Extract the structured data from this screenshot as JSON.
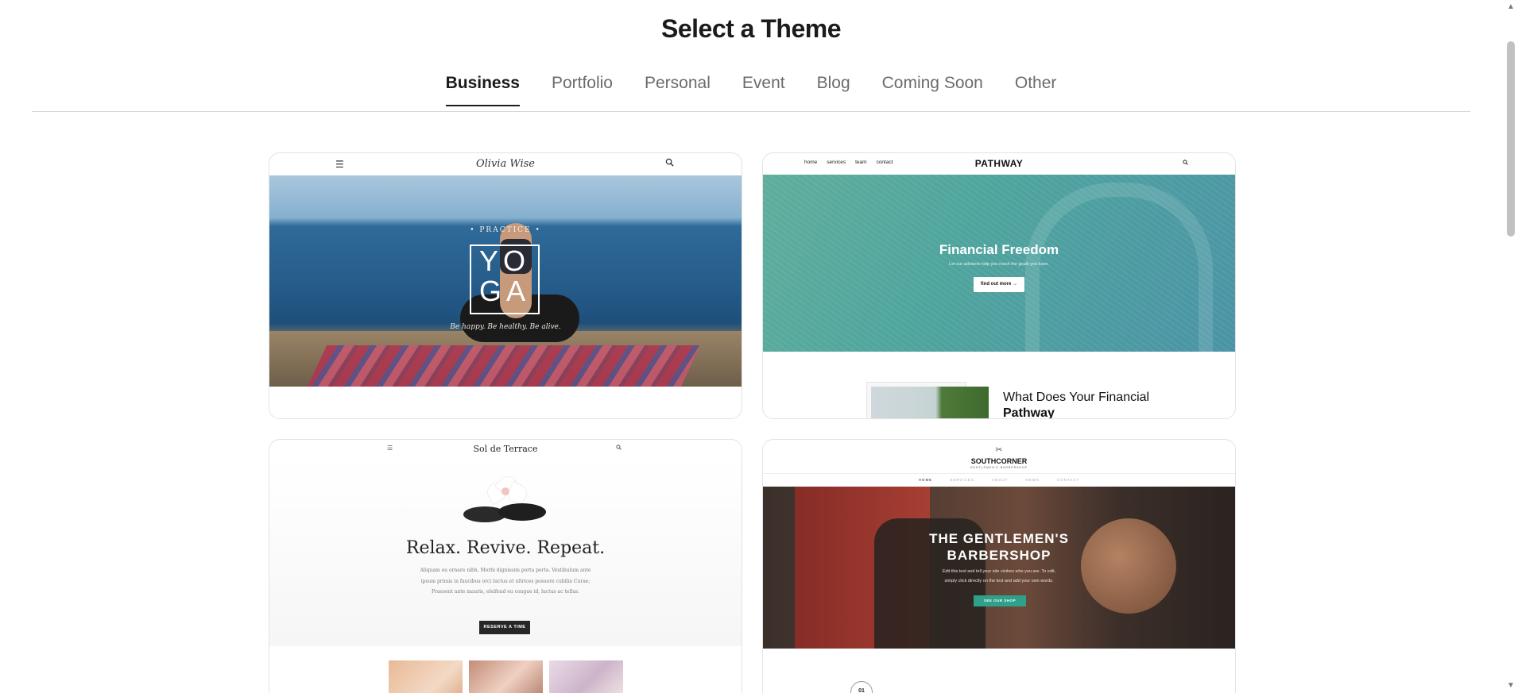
{
  "page": {
    "title": "Select a Theme"
  },
  "tabs": [
    {
      "label": "Business",
      "active": true
    },
    {
      "label": "Portfolio",
      "active": false
    },
    {
      "label": "Personal",
      "active": false
    },
    {
      "label": "Event",
      "active": false
    },
    {
      "label": "Blog",
      "active": false
    },
    {
      "label": "Coming Soon",
      "active": false
    },
    {
      "label": "Other",
      "active": false
    }
  ],
  "themes": [
    {
      "brand": "Olivia Wise",
      "menu_icon": "hamburger-icon",
      "search_icon": "search-icon",
      "kicker": "• PRACTICE •",
      "hero_line1": "YO",
      "hero_line2": "GA",
      "tagline": "Be happy. Be healthy. Be alive."
    },
    {
      "brand": "PATHWAY",
      "nav": [
        "home",
        "services",
        "team",
        "contact"
      ],
      "search_icon": "search-icon",
      "headline": "Financial Freedom",
      "sub": "Let our advisors help you reach the goals you have.",
      "button": "find out more →",
      "question_plain": "What Does Your Financial ",
      "question_bold": "Pathway"
    },
    {
      "brand": "Sol de Terrace",
      "menu_icon": "hamburger-icon",
      "search_icon": "search-icon",
      "headline": "Relax. Revive. Repeat.",
      "body": "Aliquam eu ornare nibh. Morbi dignissim porta porta. Vestibulum ante ipsum primis in faucibus orci luctus et ultrices posuere cubilia Curae; Praesent ante mauris, eleifend eu congue id, luctus ac tellus.",
      "button": "RESERVE A TIME"
    },
    {
      "brand": "SOUTHCORNER",
      "tag": "GENTLEMEN'S BARBERSHOP",
      "logo_icon": "scissors-icon",
      "nav": [
        "HOME",
        "SERVICES",
        "ABOUT",
        "NEWS",
        "CONTACT"
      ],
      "headline_line1": "THE GENTLEMEN'S",
      "headline_line2": "BARBERSHOP",
      "sub_line1": "Edit this text and tell your site visitors who you are. To edit,",
      "sub_line2": "simply click directly on the text and add your own words.",
      "button": "SEE OUR SHOP",
      "step": "01"
    }
  ],
  "colors": {
    "accent_text": "#1b1b1b",
    "muted_tab": "#6b6b6b",
    "pathway_teal": "#4fa59d",
    "barber_green": "#2fa089"
  }
}
